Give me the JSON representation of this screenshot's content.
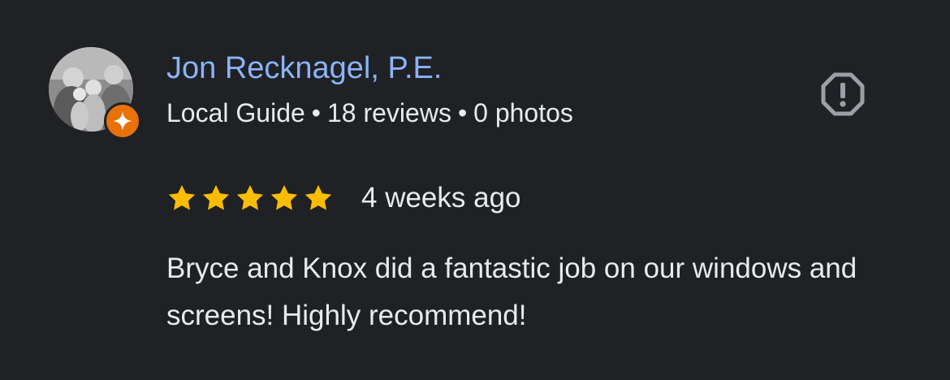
{
  "author": {
    "name": "Jon Recknagel, P.E.",
    "badge": "Local Guide",
    "reviews": "18 reviews",
    "photos": "0 photos",
    "separator": "•",
    "avatar_icon": "profile-photo",
    "badge_icon": "local-guide-star-icon"
  },
  "actions": {
    "report_icon": "report-icon"
  },
  "review": {
    "rating": 5,
    "max_rating": 5,
    "date": "4 weeks ago",
    "text": "Bryce and Knox did a fantastic job on our windows and screens! Highly recommend!"
  },
  "colors": {
    "background": "#202124",
    "name": "#8ab4f8",
    "text": "#e8eaed",
    "star": "#fbbc04",
    "badge": "#e8710a",
    "icon": "#9aa0a6"
  }
}
